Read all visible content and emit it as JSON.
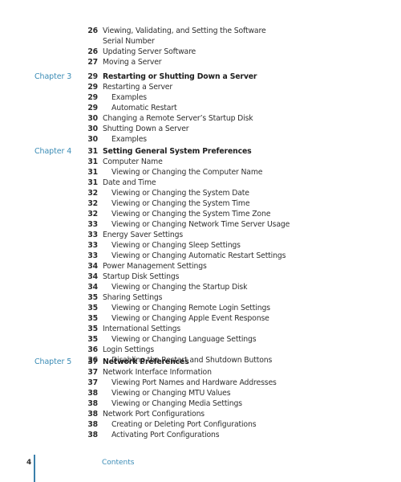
{
  "page": {
    "page_number": "4",
    "running_head": "Contents",
    "accent_color": "#3a8bb5"
  },
  "continued": {
    "entries": [
      {
        "page": "26",
        "title": "Viewing, Validating, and Setting the Software",
        "level": 1
      },
      {
        "page": "",
        "title": "Serial Number",
        "level": 1
      },
      {
        "page": "26",
        "title": "Updating Server Software",
        "level": 1
      },
      {
        "page": "27",
        "title": "Moving a Server",
        "level": 1
      }
    ]
  },
  "chapters": [
    {
      "label": "Chapter 3",
      "entries": [
        {
          "page": "29",
          "title": "Restarting or Shutting Down a Server",
          "level": 0
        },
        {
          "page": "29",
          "title": "Restarting a Server",
          "level": 1
        },
        {
          "page": "29",
          "title": "Examples",
          "level": 2
        },
        {
          "page": "29",
          "title": "Automatic Restart",
          "level": 2
        },
        {
          "page": "30",
          "title": "Changing a Remote Server’s Startup Disk",
          "level": 1
        },
        {
          "page": "30",
          "title": "Shutting Down a Server",
          "level": 1
        },
        {
          "page": "30",
          "title": "Examples",
          "level": 2
        }
      ]
    },
    {
      "label": "Chapter 4",
      "entries": [
        {
          "page": "31",
          "title": "Setting General System Preferences",
          "level": 0
        },
        {
          "page": "31",
          "title": "Computer Name",
          "level": 1
        },
        {
          "page": "31",
          "title": "Viewing or Changing the Computer Name",
          "level": 2
        },
        {
          "page": "31",
          "title": "Date and Time",
          "level": 1
        },
        {
          "page": "32",
          "title": "Viewing or Changing the System Date",
          "level": 2
        },
        {
          "page": "32",
          "title": "Viewing or Changing the System Time",
          "level": 2
        },
        {
          "page": "32",
          "title": "Viewing or Changing the System Time Zone",
          "level": 2
        },
        {
          "page": "33",
          "title": "Viewing or Changing Network Time Server Usage",
          "level": 2
        },
        {
          "page": "33",
          "title": "Energy Saver Settings",
          "level": 1
        },
        {
          "page": "33",
          "title": "Viewing or Changing Sleep Settings",
          "level": 2
        },
        {
          "page": "33",
          "title": "Viewing or Changing Automatic Restart Settings",
          "level": 2
        },
        {
          "page": "34",
          "title": "Power Management Settings",
          "level": 1
        },
        {
          "page": "34",
          "title": "Startup Disk Settings",
          "level": 1
        },
        {
          "page": "34",
          "title": "Viewing or Changing the Startup Disk",
          "level": 2
        },
        {
          "page": "35",
          "title": "Sharing Settings",
          "level": 1
        },
        {
          "page": "35",
          "title": "Viewing or Changing Remote Login Settings",
          "level": 2
        },
        {
          "page": "35",
          "title": "Viewing or Changing Apple Event Response",
          "level": 2
        },
        {
          "page": "35",
          "title": "International Settings",
          "level": 1
        },
        {
          "page": "35",
          "title": "Viewing or Changing Language Settings",
          "level": 2
        },
        {
          "page": "36",
          "title": "Login Settings",
          "level": 1
        },
        {
          "page": "36",
          "title": "Disabling the Restart and Shutdown Buttons",
          "level": 2
        }
      ]
    },
    {
      "label": "Chapter 5",
      "entries": [
        {
          "page": "37",
          "title": "Network Preferences",
          "level": 0
        },
        {
          "page": "37",
          "title": "Network Interface Information",
          "level": 1
        },
        {
          "page": "37",
          "title": "Viewing Port Names and Hardware Addresses",
          "level": 2
        },
        {
          "page": "38",
          "title": "Viewing or Changing MTU Values",
          "level": 2
        },
        {
          "page": "38",
          "title": "Viewing or Changing Media Settings",
          "level": 2
        },
        {
          "page": "38",
          "title": "Network Port Configurations",
          "level": 1
        },
        {
          "page": "38",
          "title": "Creating or Deleting Port Configurations",
          "level": 2
        },
        {
          "page": "38",
          "title": "Activating Port Configurations",
          "level": 2
        }
      ]
    }
  ]
}
